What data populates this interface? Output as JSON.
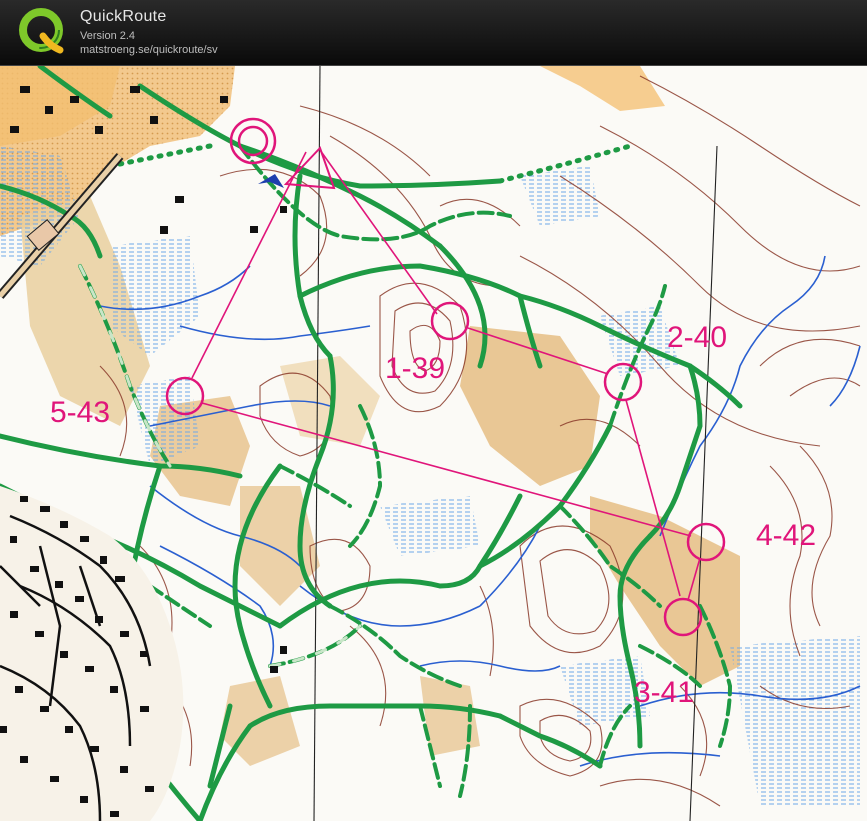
{
  "app": {
    "title": "QuickRoute",
    "version": "Version 2.4",
    "url": "matstroeng.se/quickroute/sv",
    "logo_icon": "quickroute-q-logo"
  },
  "colors": {
    "control": "#e0157a",
    "path": "#1e9a44",
    "contour": "#8a3a2a",
    "water": "#2a5fd0",
    "marsh": "#6ea8e8",
    "open_land": "#f0b060",
    "rough_open": "#e8c890",
    "building": "#111111",
    "paper": "#fbfaf6"
  },
  "map": {
    "start_icon": "start-triangle-icon",
    "finish_icon": "finish-double-circle-icon",
    "controls": [
      {
        "label": "1-39"
      },
      {
        "label": "2-40"
      },
      {
        "label": "3-41"
      },
      {
        "label": "4-42"
      },
      {
        "label": "5-43"
      }
    ]
  }
}
